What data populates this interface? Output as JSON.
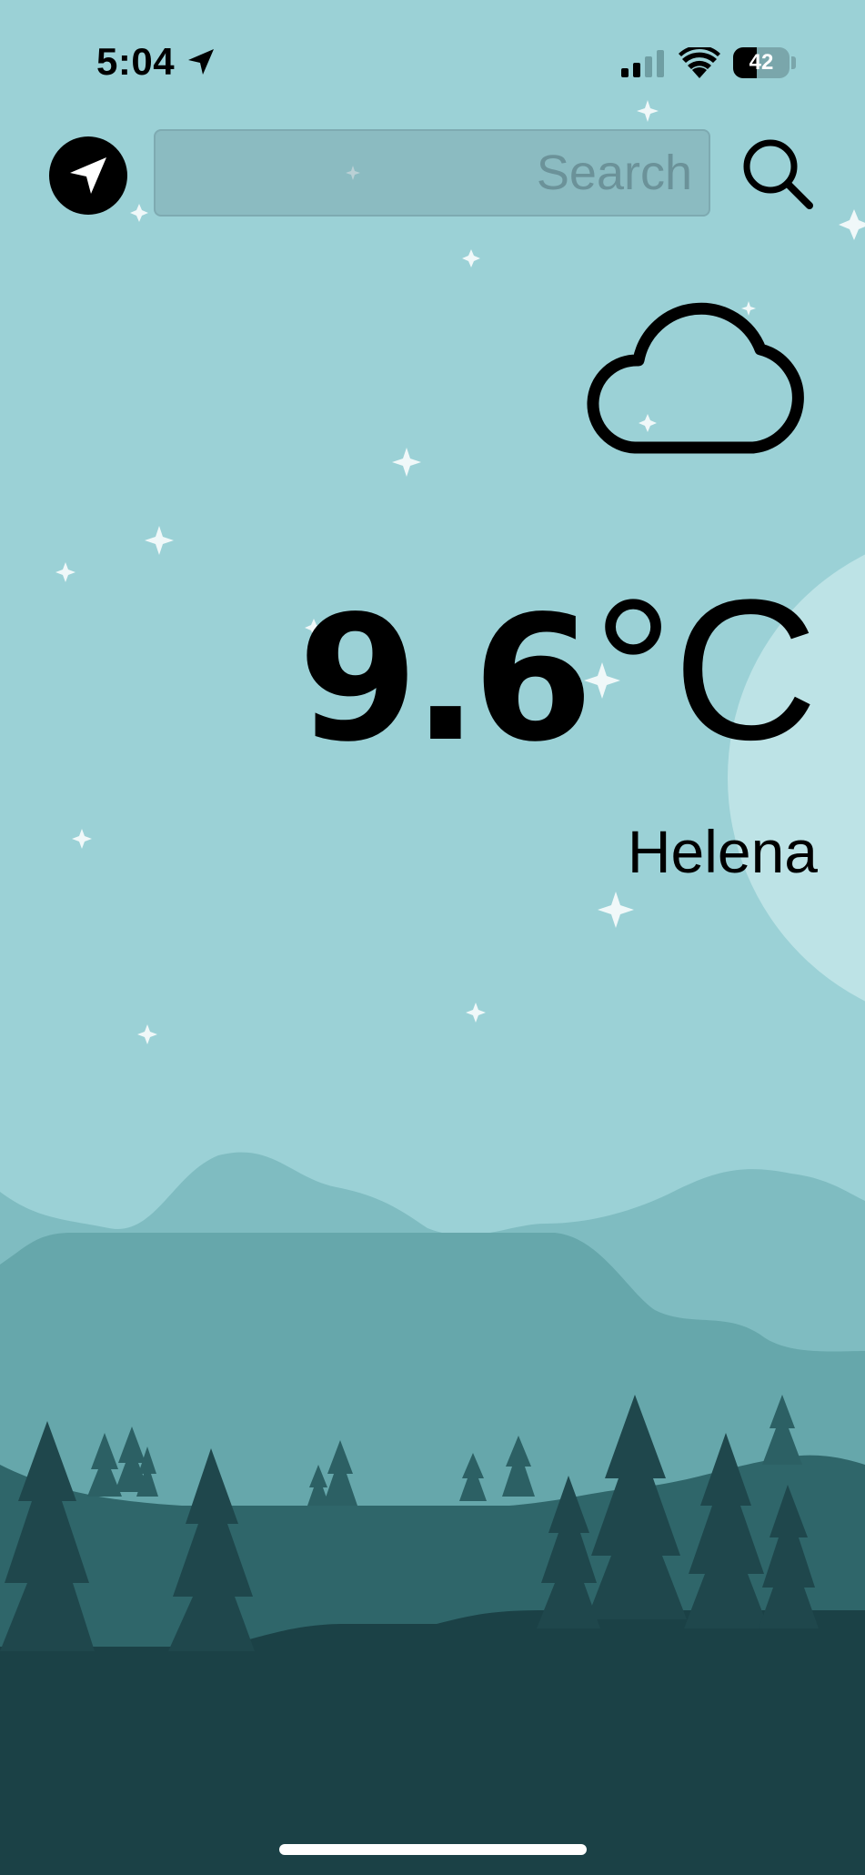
{
  "status_bar": {
    "time": "5:04",
    "battery_level": "42",
    "battery_fraction": 0.42
  },
  "search": {
    "placeholder": "Search",
    "value": ""
  },
  "weather": {
    "condition_icon": "cloud-icon",
    "temperature_value": "9.6",
    "temperature_unit": "°C",
    "city": "Helena"
  },
  "colors": {
    "sky": "#9bd1d6",
    "moon": "#bde3e6",
    "far_hills": "#7fbcc1",
    "mid_hills": "#66a7ab",
    "near_hills": "#2f666a",
    "foreground": "#1b4146",
    "trees_far": "#2c6064",
    "trees_near": "#1f474c",
    "text": "#000000"
  },
  "icons": {
    "location": "navigation-arrow-icon",
    "search": "magnifier-icon",
    "signal": "cellular-signal-icon",
    "wifi": "wifi-icon",
    "battery": "battery-icon"
  }
}
